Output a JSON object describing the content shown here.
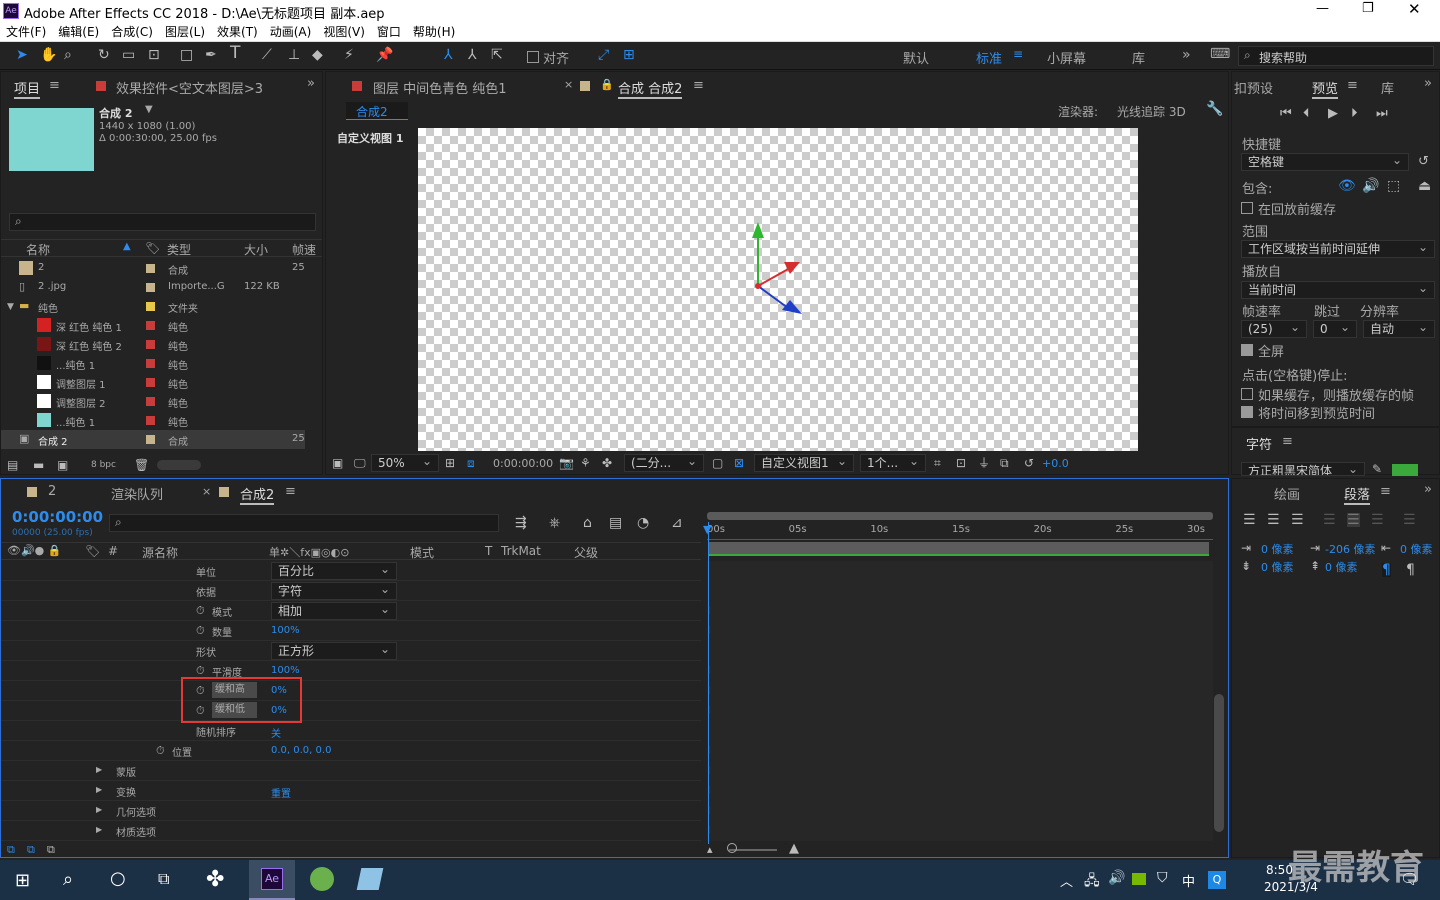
{
  "window": {
    "title": "Adobe After Effects CC 2018 - D:\\Ae\\无标题项目 副本.aep",
    "app_badge": "Ae"
  },
  "menu": [
    "文件(F)",
    "编辑(E)",
    "合成(C)",
    "图层(L)",
    "效果(T)",
    "动画(A)",
    "视图(V)",
    "窗口",
    "帮助(H)"
  ],
  "toolbar": {
    "align": "对齐",
    "workspaces": [
      "默认",
      "标准",
      "小屏幕",
      "库"
    ],
    "active_workspace": "标准",
    "search_placeholder": "搜索帮助"
  },
  "project": {
    "tab": "项目",
    "effects_tab": "效果控件<空文本图层>3",
    "comp_name": "合成 2",
    "comp_size": "1440 x 1080 (1.00)",
    "comp_duration": "Δ 0:00:30:00, 25.00 fps",
    "columns": [
      "名称",
      "类型",
      "大小",
      "帧速"
    ],
    "items": [
      {
        "name": "2",
        "type": "合成",
        "size": "",
        "fps": "25",
        "swatch": "#c8b48c",
        "label": "#c8b48c"
      },
      {
        "name": "2 .jpg",
        "type": "Importe...G",
        "size": "122 KB",
        "fps": "",
        "swatch": "",
        "label": "#c8b48c"
      },
      {
        "name": "纯色",
        "type": "文件夹",
        "size": "",
        "fps": "",
        "swatch": "",
        "label": "#e8c84a"
      },
      {
        "name": "深 红色 纯色 1",
        "type": "纯色",
        "size": "",
        "fps": "",
        "swatch": "#d42222",
        "label": "#c83c3c"
      },
      {
        "name": "深 红色 纯色 2",
        "type": "纯色",
        "size": "",
        "fps": "",
        "swatch": "#7a1515",
        "label": "#c83c3c"
      },
      {
        "name": "...纯色 1",
        "type": "纯色",
        "size": "",
        "fps": "",
        "swatch": "#111111",
        "label": "#c83c3c"
      },
      {
        "name": "调整图层 1",
        "type": "纯色",
        "size": "",
        "fps": "",
        "swatch": "#ffffff",
        "label": "#c83c3c"
      },
      {
        "name": "调整图层 2",
        "type": "纯色",
        "size": "",
        "fps": "",
        "swatch": "#ffffff",
        "label": "#c83c3c"
      },
      {
        "name": "...纯色 1",
        "type": "纯色",
        "size": "",
        "fps": "",
        "swatch": "#7fd6d0",
        "label": "#c83c3c"
      },
      {
        "name": "合成 2",
        "type": "合成",
        "size": "",
        "fps": "25",
        "swatch": "",
        "label": "#c8b48c"
      }
    ],
    "bpc": "8 bpc"
  },
  "viewer": {
    "layer_tab": "图层 中间色青色 纯色1",
    "comp_tab": "合成 合成2",
    "comp_tab_name": "合成2",
    "renderer_label": "渲染器:",
    "renderer": "光线追踪 3D",
    "view_label": "自定义视图 1",
    "zoom": "50%",
    "timecode": "0:00:00:00",
    "resolution": "(二分...",
    "view": "自定义视图1",
    "views_count": "1个...",
    "exposure": "+0.0"
  },
  "preview": {
    "tab_presets": "扣预设",
    "tab_preview": "预览",
    "tab_lib": "库",
    "shortcut_label": "快捷键",
    "shortcut": "空格键",
    "include": "包含:",
    "cache_before": "在回放前缓存",
    "range_label": "范围",
    "range": "工作区域按当前时间延伸",
    "play_from_label": "播放自",
    "play_from": "当前时间",
    "fps_label": "帧速率",
    "skip_label": "跳过",
    "res_label": "分辨率",
    "fps": "(25)",
    "skip": "0",
    "res": "自动",
    "fullscreen": "全屏",
    "stop_label": "点击(空格键)停止:",
    "if_cached": "如果缓存，则播放缓存的帧",
    "move_time": "将时间移到预览时间",
    "char_tab": "字符",
    "font": "方正粗黑宋简体"
  },
  "paragraph": {
    "tab_draw": "绘画",
    "tab_para": "段落",
    "indent_left": "0 像素",
    "indent_first": "-206 像素",
    "indent_right": "0 像素",
    "space_before": "0 像素",
    "space_after": "0 像素"
  },
  "timeline": {
    "tabs": [
      "2",
      "渲染队列",
      "合成2"
    ],
    "timecode": "0:00:00:00",
    "frames": "00000 (25.00 fps)",
    "columns": [
      "源名称",
      "模式",
      "T",
      "TrkMat",
      "父级"
    ],
    "ruler": [
      "00s",
      "05s",
      "10s",
      "15s",
      "20s",
      "25s",
      "30s"
    ],
    "rows": [
      {
        "label": "单位",
        "value": "百分比",
        "dropdown": true,
        "stopwatch": false
      },
      {
        "label": "依据",
        "value": "字符",
        "dropdown": true,
        "stopwatch": false
      },
      {
        "label": "模式",
        "value": "相加",
        "dropdown": true,
        "stopwatch": true
      },
      {
        "label": "数量",
        "value": "100%",
        "dropdown": false,
        "stopwatch": true
      },
      {
        "label": "形状",
        "value": "正方形",
        "dropdown": true,
        "stopwatch": false
      },
      {
        "label": "平滑度",
        "value": "100%",
        "dropdown": false,
        "stopwatch": true
      },
      {
        "label": "缓和高",
        "value": "0%",
        "dropdown": false,
        "stopwatch": true
      },
      {
        "label": "缓和低",
        "value": "0%",
        "dropdown": false,
        "stopwatch": true
      },
      {
        "label": "随机排序",
        "value": "关",
        "dropdown": false,
        "stopwatch": false
      },
      {
        "label": "位置",
        "value": "0.0, 0.0, 0.0",
        "dropdown": false,
        "stopwatch": true
      },
      {
        "label": "蒙版",
        "value": "",
        "dropdown": false,
        "stopwatch": false
      },
      {
        "label": "变换",
        "value": "重置",
        "dropdown": false,
        "stopwatch": false
      },
      {
        "label": "几何选项",
        "value": "",
        "dropdown": false,
        "stopwatch": false
      },
      {
        "label": "材质选项",
        "value": "",
        "dropdown": false,
        "stopwatch": false
      }
    ]
  },
  "taskbar": {
    "time": "8:50",
    "date": "2021/3/4",
    "ime": "中",
    "watermark": "最需教育"
  },
  "colors": {
    "accent": "#2d8ceb",
    "panel": "#232323",
    "highlight_box": "#e53935"
  }
}
